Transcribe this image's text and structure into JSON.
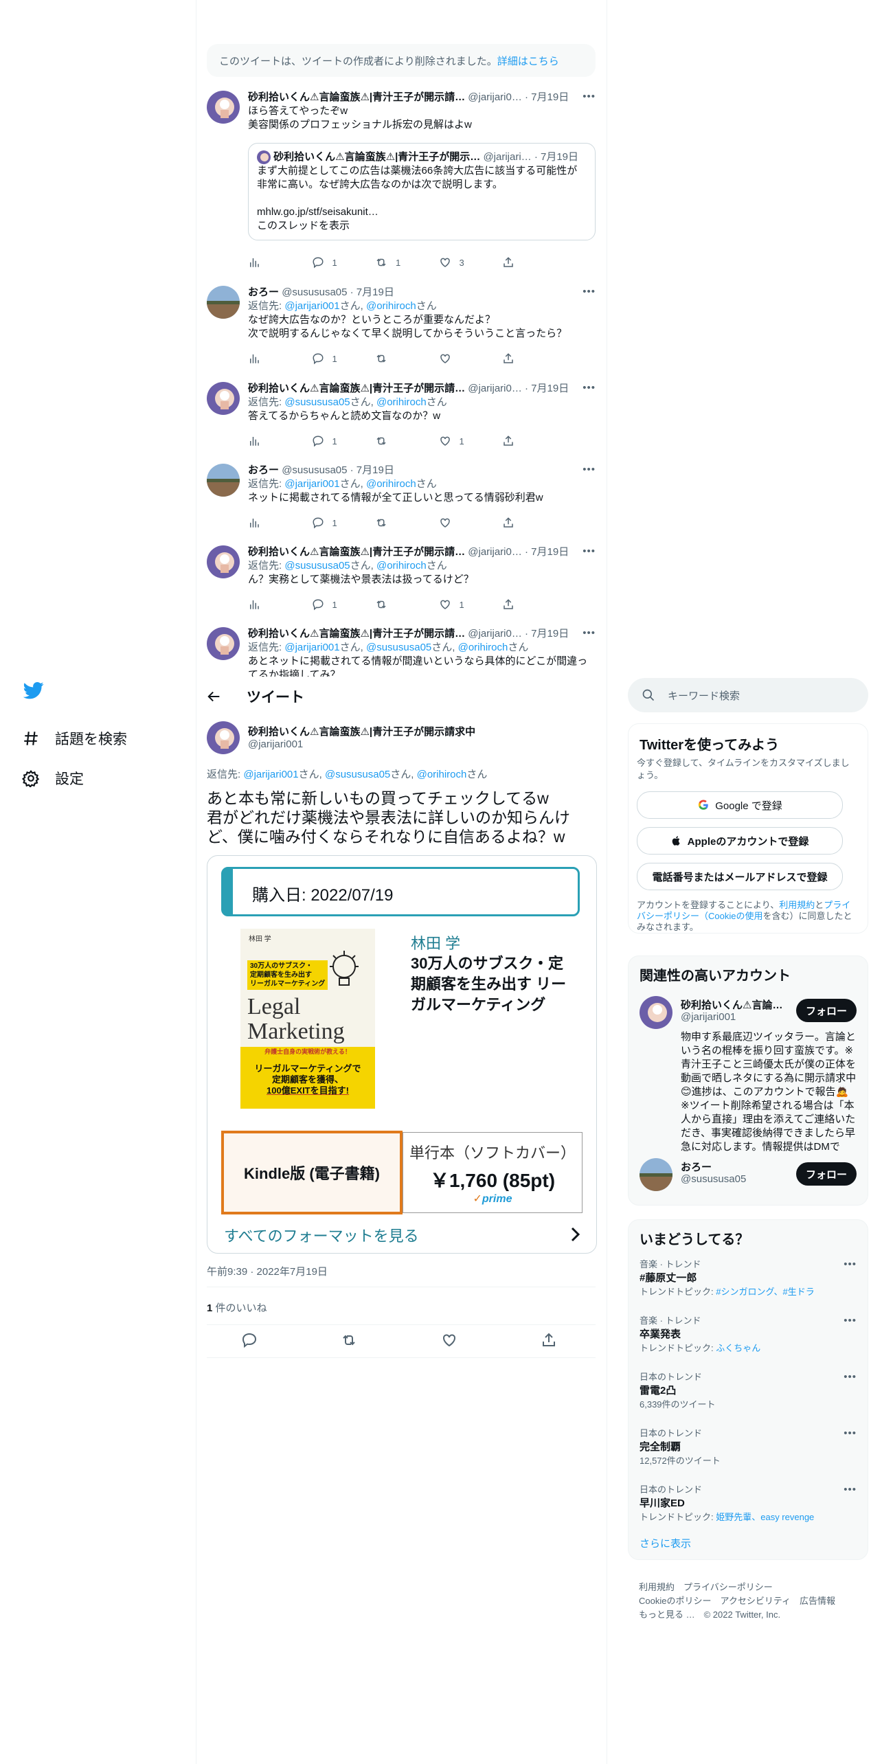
{
  "nav": {
    "explore_label": "話題を検索",
    "settings_label": "設定"
  },
  "thread": {
    "deleted_notice": "このツイートは、ツイートの作成者により削除されました。",
    "deleted_link": "詳細はこちら",
    "tweets": [
      {
        "name": "砂利拾いくん⚠言論蛮族⚠|青汁王子が開示請…",
        "handle": "@jarijari0… · 7月19日",
        "lines": [
          "ほら答えてやったぞw",
          "美容関係のプロフェッショナル拆宏の見解はよw"
        ],
        "quote": {
          "name": "砂利拾いくん⚠言論蛮族⚠|青汁王子が開示…",
          "handle": "@jarijari… · 7月19日",
          "lines": [
            "まず大前提としてこの広告は薬機法66条誇大広告に該当する可能性が",
            "非常に高い。なぜ誇大広告なのかは次で説明します。",
            "",
            "mhlw.go.jp/stf/seisakunit…"
          ],
          "link": "このスレッドを表示"
        },
        "counts": {
          "reply": "1",
          "retweet": "1",
          "like": "3"
        }
      },
      {
        "name": "おろー",
        "handle": "@susususa05 · 7月19日",
        "reply_prefix": "返信先: ",
        "reply_to": [
          "@jarijari001",
          "@orihiroch"
        ],
        "reply_suffix": "さん",
        "lines": [
          "なぜ誇大広告なのか？というところが重要なんだよ？",
          "次で説明するんじゃなくて早く説明してからそういうこと言ったら？"
        ],
        "counts": {
          "reply": "1",
          "retweet": "",
          "like": ""
        }
      },
      {
        "name": "砂利拾いくん⚠言論蛮族⚠|青汁王子が開示請…",
        "handle": "@jarijari0… · 7月19日",
        "reply_prefix": "返信先: ",
        "reply_to": [
          "@susususa05",
          "@orihiroch"
        ],
        "reply_suffix": "さん",
        "lines": [
          "答えてるからちゃんと読め文盲なのか？w"
        ],
        "counts": {
          "reply": "1",
          "retweet": "",
          "like": "1"
        }
      },
      {
        "name": "おろー",
        "handle": "@susususa05 · 7月19日",
        "reply_prefix": "返信先: ",
        "reply_to": [
          "@jarijari001",
          "@orihiroch"
        ],
        "reply_suffix": "さん",
        "lines": [
          "ネットに掲載されてる情報が全て正しいと思ってる情弱砂利君w"
        ],
        "counts": {
          "reply": "1",
          "retweet": "",
          "like": ""
        }
      },
      {
        "name": "砂利拾いくん⚠言論蛮族⚠|青汁王子が開示請…",
        "handle": "@jarijari0… · 7月19日",
        "reply_prefix": "返信先: ",
        "reply_to": [
          "@susususa05",
          "@orihiroch"
        ],
        "reply_suffix": "さん",
        "lines": [
          "ん？実務として薬機法や景表法は扱ってるけど？"
        ],
        "counts": {
          "reply": "1",
          "retweet": "",
          "like": "1"
        }
      },
      {
        "name": "砂利拾いくん⚠言論蛮族⚠|青汁王子が開示請…",
        "handle": "@jarijari0… · 7月19日",
        "reply_prefix": "返信先: ",
        "reply_to": [
          "@jarijari001",
          "@susususa05",
          "@orihiroch"
        ],
        "reply_suffix": "さん",
        "lines": [
          "あとネットに掲載されてる情報が間違いというなら具体的にどこが間違っ",
          "てるか指摘してみ？"
        ],
        "counts": {
          "reply": "",
          "retweet": "",
          "like": ""
        }
      }
    ]
  },
  "main": {
    "header_title": "ツイート",
    "author_name": "砂利拾いくん⚠言論蛮族⚠|青汁王子が開示請求中",
    "author_handle": "@jarijari001",
    "reply_prefix": "返信先: ",
    "reply_1": "@jarijari001",
    "reply_2": "@susususa05",
    "reply_3": "@orihiroch",
    "reply_suffix": "さん",
    "text_lines": [
      "あと本も常に新しいもの買ってチェックしてるw",
      "君がどれだけ薬機法や景表法に詳しいのか知らんけ",
      "ど、僕に噛み付くならそれなりに自信あるよね？w"
    ],
    "card": {
      "purchase_date": "購入日: 2022/07/19",
      "book_author": "林田 学",
      "book_title": [
        "30万人のサブスク・定",
        "期顧客を生み出す リー",
        "ガルマーケティング"
      ],
      "cover_author": "林田 学",
      "cover_tagline": [
        "30万人のサブスク・",
        "定期顧客を生み出す",
        "リーガルマーケティング"
      ],
      "cover_title": [
        "Legal",
        "Marketing"
      ],
      "cover_band": "弁護士自身の実戦術が教える！",
      "cover_bottom": [
        "リーガルマーケティングで",
        "定期顧客を獲得、",
        "100億EXITを目指す!"
      ],
      "kindle_label": "Kindle版 (電子書籍)",
      "paper_label": "単行本（ソフトカバー）",
      "paper_price": "￥1,760 (85pt)",
      "prime": "prime",
      "formats_link": "すべてのフォーマットを見る"
    },
    "timestamp": "午前9:39 · 2022年7月19日",
    "likes_count": "1",
    "likes_label": " 件のいいね"
  },
  "right": {
    "search_placeholder": "キーワード検索",
    "signup": {
      "title": "Twitterを使ってみよう",
      "desc": "今すぐ登録して、タイムラインをカスタマイズしましょう。",
      "google": "Google で登録",
      "apple": "Appleのアカウントで登録",
      "phone": "電話番号またはメールアドレスで登録",
      "terms_a": "アカウントを登録することにより、",
      "terms_link1": "利用規約",
      "terms_b": "と",
      "terms_link2": "プライバシーポリシー（Cookieの使用",
      "terms_c": "を含む）に同意したとみなされます。"
    },
    "related": {
      "title": "関連性の高いアカウント",
      "accounts": [
        {
          "name": "砂利拾いくん⚠言論…",
          "handle": "@jarijari001",
          "follow": "フォロー",
          "bio": [
            "物申す系最底辺ツイッタラー。言論と",
            "いう名の棍棒を振り回す蛮族です。※",
            "青汁王子こと三崎優太氏が僕の正体を",
            "動画で晒しネタにする為に開示請求中",
            "😊進捗は、このアカウントで報告🙇",
            "※ツイート削除希望される場合は「本",
            "人から直接」理由を添えてご連絡いた",
            "だき、事実確認後納得できましたら早",
            "急に対応します。情報提供はDMで"
          ]
        },
        {
          "name": "おろー",
          "handle": "@susususa05",
          "follow": "フォロー"
        }
      ]
    },
    "trends": {
      "title": "いまどうしてる？",
      "items": [
        {
          "context": "音楽 · トレンド",
          "name": "#藤原丈一郎",
          "meta_prefix": "トレンドトピック: ",
          "meta_links": "#シンガロング、#生ドラ"
        },
        {
          "context": "音楽 · トレンド",
          "name": "卒業発表",
          "meta_prefix": "トレンドトピック: ",
          "meta_links": "ふくちゃん"
        },
        {
          "context": "日本のトレンド",
          "name": "雷電2凸",
          "meta_prefix": "6,339件のツイート",
          "meta_links": ""
        },
        {
          "context": "日本のトレンド",
          "name": "完全制覇",
          "meta_prefix": "12,572件のツイート",
          "meta_links": ""
        },
        {
          "context": "日本のトレンド",
          "name": "早川家ED",
          "meta_prefix": "トレンドトピック: ",
          "meta_links": "姫野先輩、easy revenge"
        }
      ],
      "show_more": "さらに表示"
    },
    "footer": {
      "line1": "利用規約　プライバシーポリシー",
      "line2": "Cookieのポリシー　アクセシビリティ　広告情報",
      "line3": "もっと見る …　© 2022 Twitter, Inc."
    }
  },
  "colors": {
    "accent": "#1d9bf0",
    "text": "#0f1419",
    "muted": "#536471",
    "amazon_orange": "#e07a1c",
    "kindle_teal": "#2aa0b5"
  }
}
